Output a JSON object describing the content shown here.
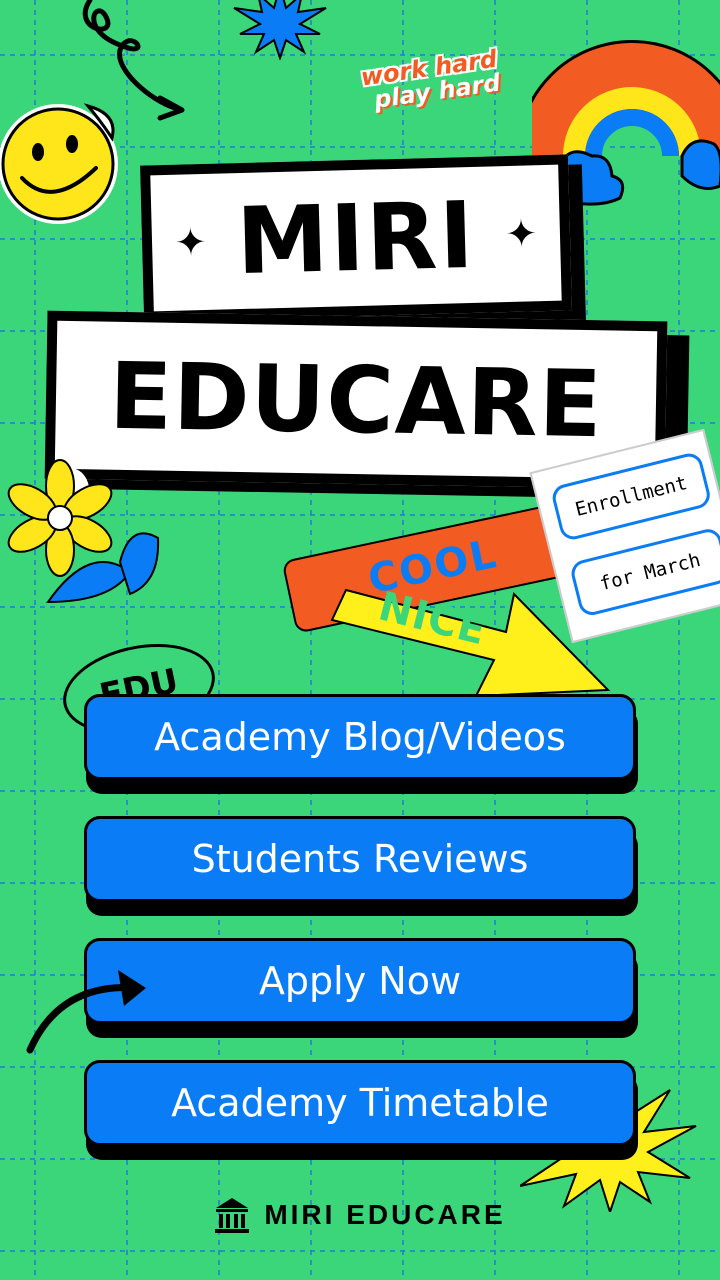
{
  "sticker_work_hard": "work hard",
  "sticker_play_hard": "play hard",
  "title_line1": "MIRI",
  "title_line2": "EDUCARE",
  "enrollment_line1": "Enrollment",
  "enrollment_line2": "for March",
  "tag_cool": "COOL",
  "tag_nice": "NICE",
  "badge_edu": "EDU",
  "buttons": [
    {
      "label": "Academy Blog/Videos"
    },
    {
      "label": "Students Reviews"
    },
    {
      "label": "Apply Now"
    },
    {
      "label": "Academy Timetable"
    }
  ],
  "footer_brand": "MIRI EDUCARE",
  "colors": {
    "background": "#3bd67a",
    "grid": "#1e7bd6",
    "button": "#0a7cf5",
    "accent_orange": "#f25c22",
    "accent_yellow": "#ffef1a"
  },
  "icons": [
    "smiley-icon",
    "rainbow-icon",
    "flower-icon",
    "star-burst-icon",
    "arrow-icon",
    "institution-icon"
  ]
}
